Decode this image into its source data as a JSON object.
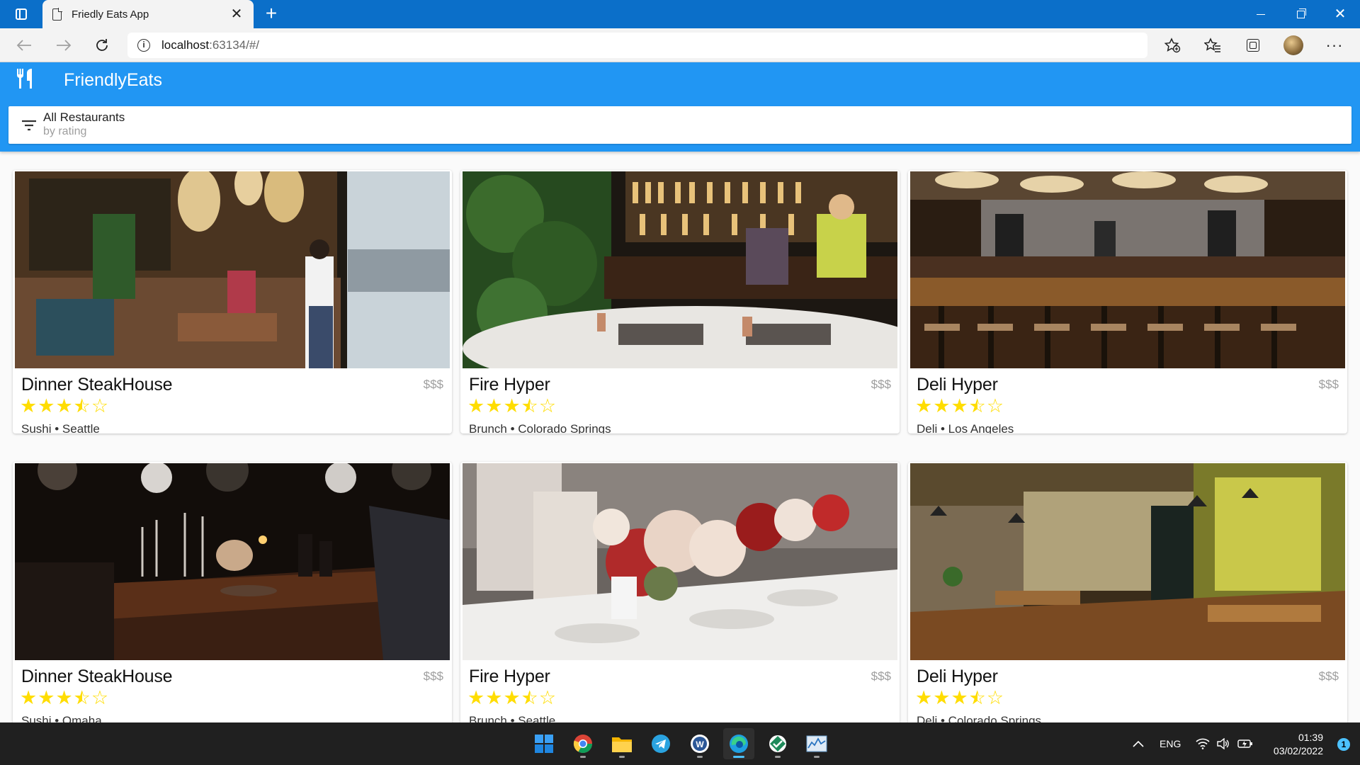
{
  "browser": {
    "tab_title": "Friedly Eats App",
    "url_host": "localhost",
    "url_rest": ":63134/#/"
  },
  "app": {
    "title": "FriendlyEats",
    "filter_title": "All Restaurants",
    "filter_subtitle": "by rating"
  },
  "restaurants": [
    {
      "name": "Dinner SteakHouse",
      "price": "$$$",
      "rating": 3.5,
      "category": "Sushi",
      "city": "Seattle",
      "meta": "Sushi • Seattle",
      "image": "restaurant-interior-photo"
    },
    {
      "name": "Fire Hyper",
      "price": "$$$",
      "rating": 3.5,
      "category": "Brunch",
      "city": "Colorado Springs",
      "meta": "Brunch • Colorado Springs",
      "image": "bar-counter-photo"
    },
    {
      "name": "Deli Hyper",
      "price": "$$$",
      "rating": 3.5,
      "category": "Deli",
      "city": "Los Angeles",
      "meta": "Deli • Los Angeles",
      "image": "open-kitchen-photo"
    },
    {
      "name": "Dinner SteakHouse",
      "price": "$$$",
      "rating": 3.5,
      "category": "Sushi",
      "city": "Omaha",
      "meta": "Sushi • Omaha",
      "image": "candlelit-table-photo"
    },
    {
      "name": "Fire Hyper",
      "price": "$$$",
      "rating": 3.5,
      "category": "Brunch",
      "city": "Seattle",
      "meta": "Brunch • Seattle",
      "image": "banquet-flowers-photo"
    },
    {
      "name": "Deli Hyper",
      "price": "$$$",
      "rating": 3.5,
      "category": "Deli",
      "city": "Colorado Springs",
      "meta": "Deli • Colorado Springs",
      "image": "dining-room-photo"
    }
  ],
  "taskbar": {
    "apps": [
      "windows-start-icon",
      "chrome-icon",
      "file-explorer-icon",
      "telegram-icon",
      "word-icon",
      "edge-icon",
      "vpn-icon",
      "task-manager-icon"
    ],
    "active_app": "edge-icon",
    "language": "ENG",
    "time": "01:39",
    "date": "03/02/2022",
    "notification_count": "1"
  },
  "colors": {
    "app_bar": "#2196f3",
    "star": "#ffdd00",
    "browser_frame": "#0b6fc9"
  }
}
